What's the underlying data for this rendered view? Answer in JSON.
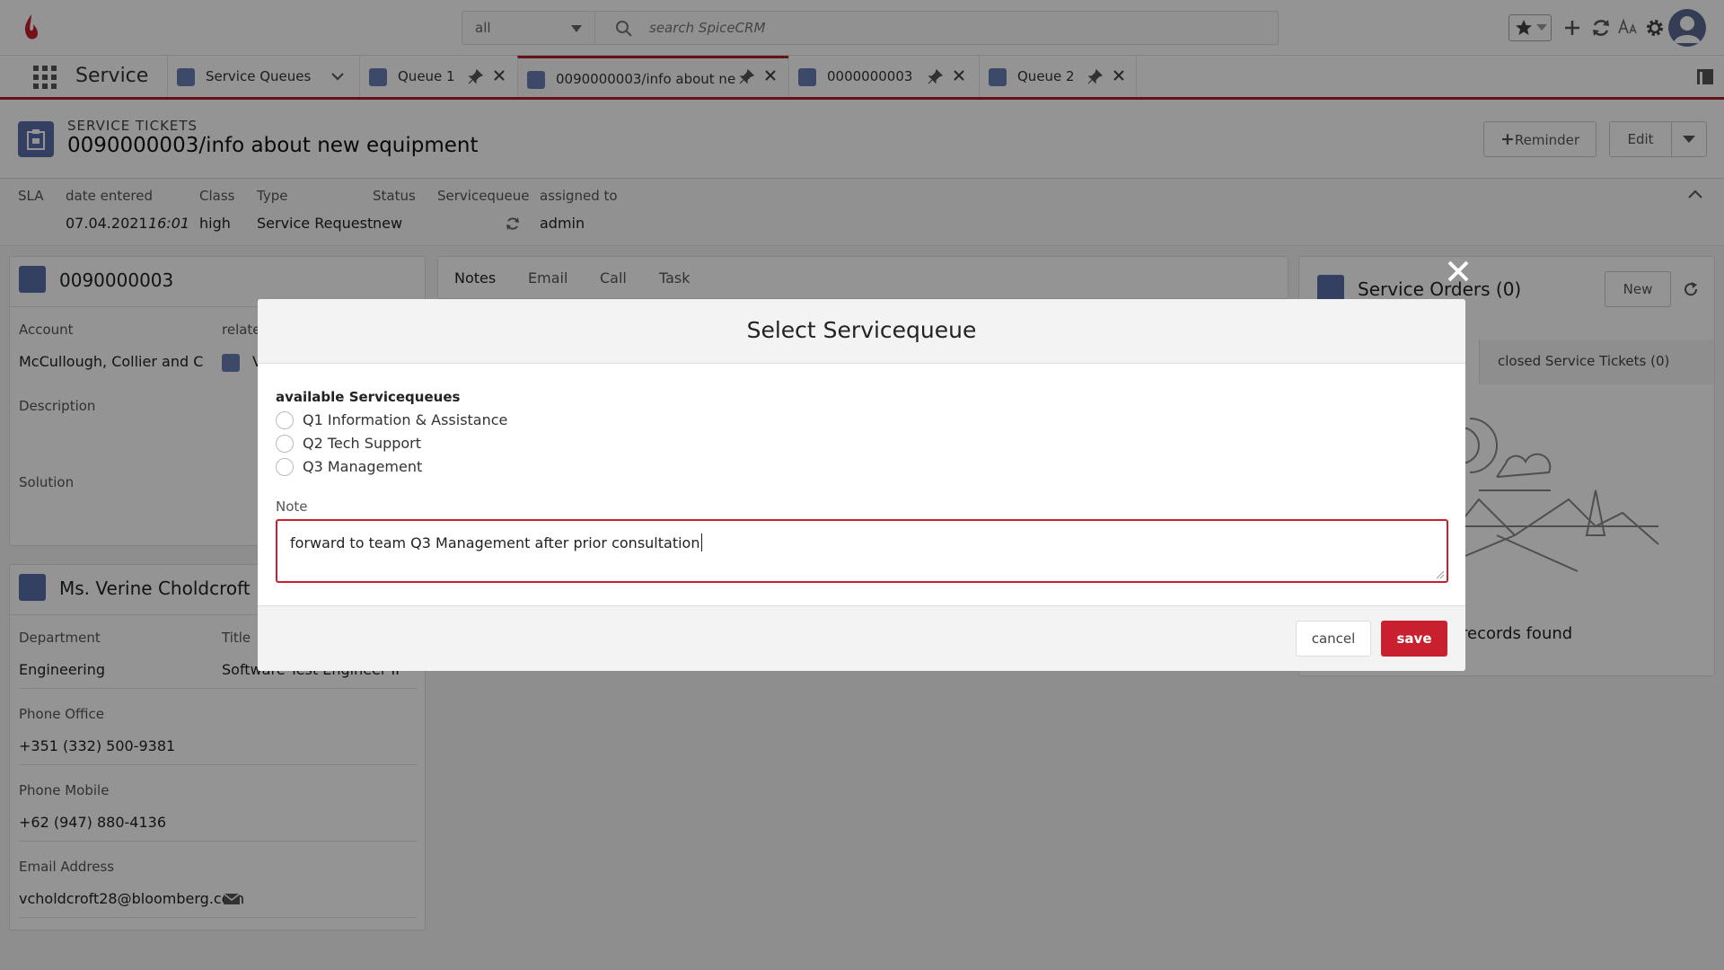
{
  "app": {
    "scope_value": "all",
    "search_placeholder": "search SpiceCRM",
    "module_title": "Service"
  },
  "tabs": [
    {
      "label": "Service Queues"
    },
    {
      "label": "Queue 1"
    },
    {
      "label": "0090000003/info about ne"
    },
    {
      "label": "0000000003"
    },
    {
      "label": "Queue 2"
    }
  ],
  "record": {
    "module": "SERVICE TICKETS",
    "title": "0090000003/info about new equipment",
    "reminder_label": "Reminder",
    "edit_label": "Edit"
  },
  "fields": {
    "labels": {
      "sla": "SLA",
      "date_entered": "date entered",
      "class": "Class",
      "type": "Type",
      "status": "Status",
      "servicequeue": "Servicequeue",
      "assigned_to": "assigned to"
    },
    "values": {
      "date": "07.04.2021",
      "time": "16:01",
      "class": "high",
      "type": "Service Request",
      "status": "new",
      "assigned_to": "admin"
    }
  },
  "ticket_card": {
    "title": "0090000003",
    "account_label": "Account",
    "account_value": "McCullough, Collier and Cron",
    "related_label": "relatec",
    "related_value": "V",
    "description_label": "Description",
    "solution_label": "Solution"
  },
  "contact_card": {
    "title": "Ms. Verine Choldcroft",
    "department_label": "Department",
    "department_value": "Engineering",
    "title_label": "Title",
    "title_value": "Software Test Engineer II",
    "phone_office_label": "Phone Office",
    "phone_office_value": "+351 (332) 500-9381",
    "phone_mobile_label": "Phone Mobile",
    "phone_mobile_value": "+62 (947) 880-4136",
    "email_label": "Email Address",
    "email_value": "vcholdcroft28@bloomberg.com"
  },
  "activity_tabs": {
    "notes": "Notes",
    "email": "Email",
    "call": "Call",
    "task": "Task"
  },
  "right_panel": {
    "title": "Service Orders (0)",
    "new_label": "New",
    "closed_tab": "closed Service Tickets (0)",
    "empty_text": "records found"
  },
  "modal": {
    "title": "Select Servicequeue",
    "available_label": "available Servicequeues",
    "options": [
      {
        "label": "Q1 Information & Assistance"
      },
      {
        "label": "Q2 Tech Support"
      },
      {
        "label": "Q3 Management"
      }
    ],
    "note_label": "Note",
    "note_value": "forward to team  Q3 Management after prior consultation",
    "cancel_label": "cancel",
    "save_label": "save"
  },
  "colors": {
    "accent": "#c8202e",
    "module_icon": "#5a6ea8"
  }
}
